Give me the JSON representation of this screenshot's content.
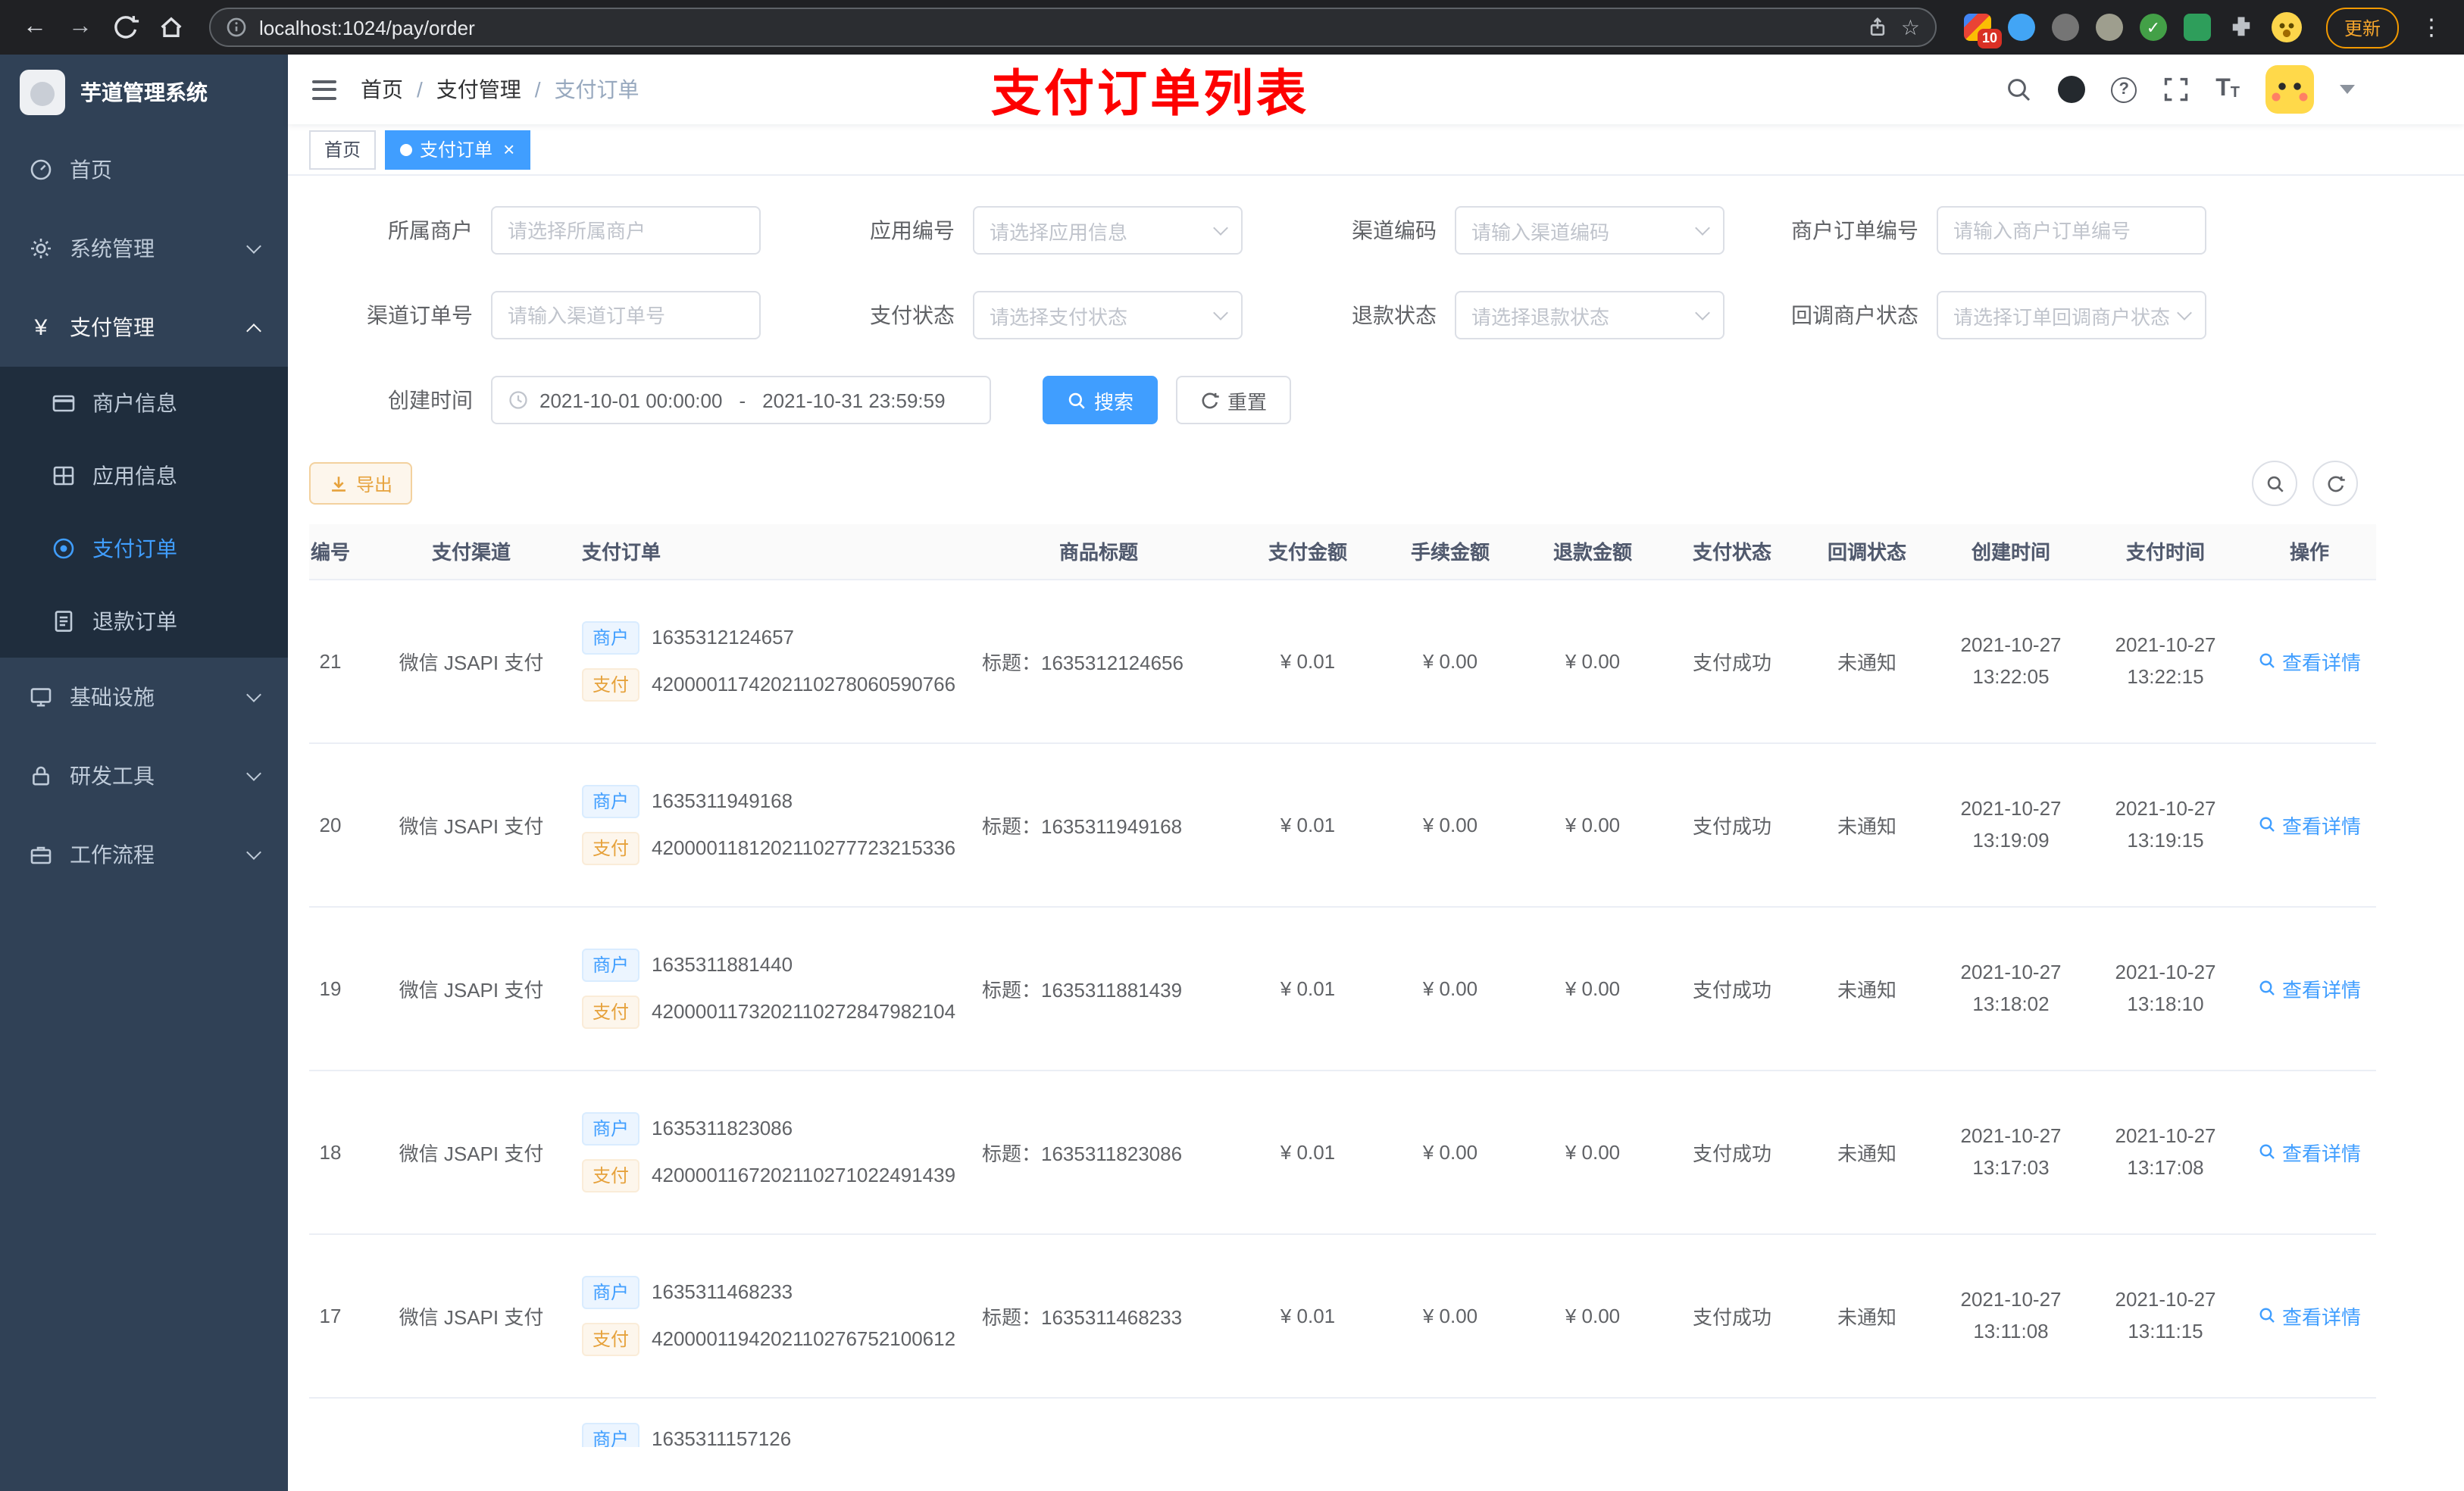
{
  "icons": {
    "yen": "¥",
    "back": "←",
    "forward": "→",
    "star": "☆",
    "kebab": "⋮",
    "question": "?",
    "font_size_large": "T",
    "font_size_small": "T",
    "tag_close": "×",
    "breadcrumb_sep": "/",
    "check": "✓"
  },
  "browser": {
    "url": "localhost:1024/pay/order",
    "update_label": "更新",
    "ext_badge": "10"
  },
  "sidebar": {
    "logo_title": "芋道管理系统",
    "home": "首页",
    "system": "系统管理",
    "pay": "支付管理",
    "merchant_info": "商户信息",
    "app_info": "应用信息",
    "pay_order": "支付订单",
    "refund_order": "退款订单",
    "infra": "基础设施",
    "devtools": "研发工具",
    "workflow": "工作流程"
  },
  "navbar": {
    "breadcrumb_home": "首页",
    "breadcrumb_pay": "支付管理",
    "breadcrumb_order": "支付订单",
    "annotation": "支付订单列表"
  },
  "tags": {
    "home": "首页",
    "active": "支付订单"
  },
  "filters": {
    "merchant": {
      "label": "所属商户",
      "placeholder": "请选择所属商户"
    },
    "app": {
      "label": "应用编号",
      "placeholder": "请选择应用信息"
    },
    "channel_code": {
      "label": "渠道编码",
      "placeholder": "请输入渠道编码"
    },
    "merchant_order_no": {
      "label": "商户订单编号",
      "placeholder": "请输入商户订单编号"
    },
    "channel_order_no": {
      "label": "渠道订单号",
      "placeholder": "请输入渠道订单号"
    },
    "pay_status": {
      "label": "支付状态",
      "placeholder": "请选择支付状态"
    },
    "refund_status": {
      "label": "退款状态",
      "placeholder": "请选择退款状态"
    },
    "notify_status": {
      "label": "回调商户状态",
      "placeholder": "请选择订单回调商户状态"
    },
    "create_time": {
      "label": "创建时间",
      "start": "2021-10-01 00:00:00",
      "separator": "-",
      "end": "2021-10-31 23:59:59"
    },
    "search_label": "搜索",
    "reset_label": "重置"
  },
  "toolbar": {
    "export_label": "导出"
  },
  "table": {
    "columns": [
      "编号",
      "支付渠道",
      "支付订单",
      "商品标题",
      "支付金额",
      "手续金额",
      "退款金额",
      "支付状态",
      "回调状态",
      "创建时间",
      "支付时间",
      "操作"
    ],
    "merchant_tag": "商户",
    "pay_tag": "支付",
    "action_label": "查看详情",
    "rows": [
      {
        "id": "21",
        "channel": "微信 JSAPI 支付",
        "merchant_no": "1635312124657",
        "pay_no": "4200001174202110278060590766",
        "title": "标题：1635312124656",
        "amount": "¥ 0.01",
        "fee": "¥ 0.00",
        "refund": "¥ 0.00",
        "status": "支付成功",
        "notify": "未通知",
        "create_date": "2021-10-27",
        "create_time": "13:22:05",
        "pay_date": "2021-10-27",
        "pay_time": "13:22:15"
      },
      {
        "id": "20",
        "channel": "微信 JSAPI 支付",
        "merchant_no": "1635311949168",
        "pay_no": "4200001181202110277723215336",
        "title": "标题：1635311949168",
        "amount": "¥ 0.01",
        "fee": "¥ 0.00",
        "refund": "¥ 0.00",
        "status": "支付成功",
        "notify": "未通知",
        "create_date": "2021-10-27",
        "create_time": "13:19:09",
        "pay_date": "2021-10-27",
        "pay_time": "13:19:15"
      },
      {
        "id": "19",
        "channel": "微信 JSAPI 支付",
        "merchant_no": "1635311881440",
        "pay_no": "4200001173202110272847982104",
        "title": "标题：1635311881439",
        "amount": "¥ 0.01",
        "fee": "¥ 0.00",
        "refund": "¥ 0.00",
        "status": "支付成功",
        "notify": "未通知",
        "create_date": "2021-10-27",
        "create_time": "13:18:02",
        "pay_date": "2021-10-27",
        "pay_time": "13:18:10"
      },
      {
        "id": "18",
        "channel": "微信 JSAPI 支付",
        "merchant_no": "1635311823086",
        "pay_no": "4200001167202110271022491439",
        "title": "标题：1635311823086",
        "amount": "¥ 0.01",
        "fee": "¥ 0.00",
        "refund": "¥ 0.00",
        "status": "支付成功",
        "notify": "未通知",
        "create_date": "2021-10-27",
        "create_time": "13:17:03",
        "pay_date": "2021-10-27",
        "pay_time": "13:17:08"
      },
      {
        "id": "17",
        "channel": "微信 JSAPI 支付",
        "merchant_no": "1635311468233",
        "pay_no": "4200001194202110276752100612",
        "title": "标题：1635311468233",
        "amount": "¥ 0.01",
        "fee": "¥ 0.00",
        "refund": "¥ 0.00",
        "status": "支付成功",
        "notify": "未通知",
        "create_date": "2021-10-27",
        "create_time": "13:11:08",
        "pay_date": "2021-10-27",
        "pay_time": "13:11:15"
      }
    ],
    "partial_row": {
      "merchant_no": "1635311157126"
    }
  }
}
